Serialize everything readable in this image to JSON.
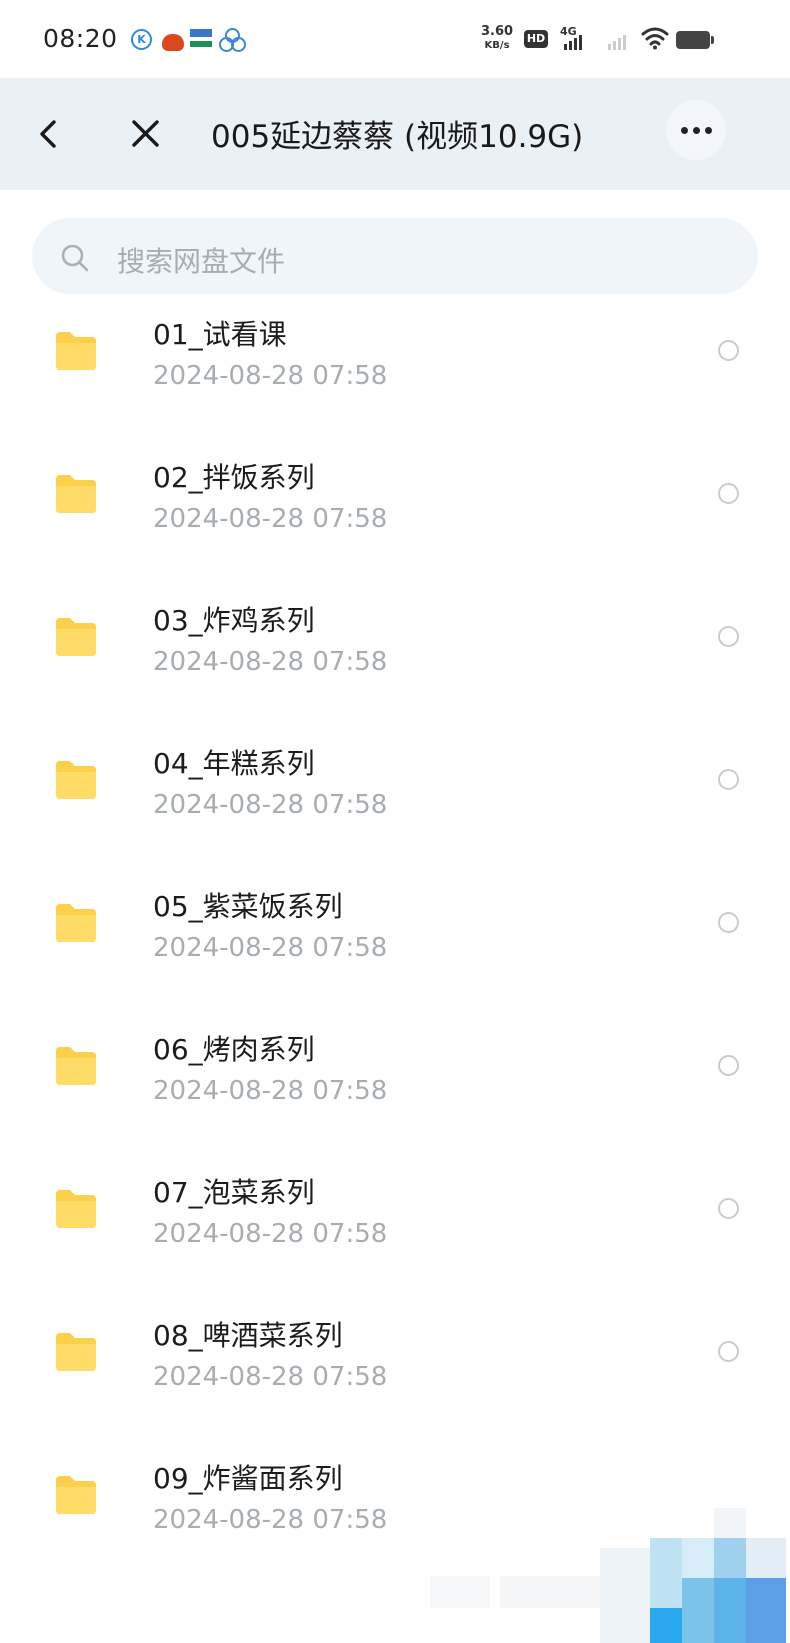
{
  "status_bar": {
    "time": "08:20",
    "net_speed_value": "3.60",
    "net_speed_unit": "KB/s",
    "hd_label": "HD",
    "network_label": "4G",
    "app_icons": [
      "k-app-icon",
      "cooking-pot-icon",
      "boat-app-icon",
      "rings-app-icon"
    ]
  },
  "title_bar": {
    "title": "005延边蔡蔡 (视频10.9G)",
    "back_icon": "chevron-left-icon",
    "close_icon": "close-icon",
    "more_icon": "more-horizontal-icon"
  },
  "search": {
    "placeholder": "搜索网盘文件",
    "icon": "search-icon"
  },
  "files": [
    {
      "name": "01_试看课",
      "date": "2024-08-28  07:58"
    },
    {
      "name": "02_拌饭系列",
      "date": "2024-08-28  07:58"
    },
    {
      "name": "03_炸鸡系列",
      "date": "2024-08-28  07:58"
    },
    {
      "name": "04_年糕系列",
      "date": "2024-08-28  07:58"
    },
    {
      "name": "05_紫菜饭系列",
      "date": "2024-08-28  07:58"
    },
    {
      "name": "06_烤肉系列",
      "date": "2024-08-28  07:58"
    },
    {
      "name": "07_泡菜系列",
      "date": "2024-08-28  07:58"
    },
    {
      "name": "08_啤酒菜系列",
      "date": "2024-08-28  07:58"
    },
    {
      "name": "09_炸酱面系列",
      "date": "2024-08-28  07:58"
    }
  ],
  "colors": {
    "folder": "#fcd04a",
    "title_bar_bg": "#e9f0f6",
    "search_bg": "#f0f5f9",
    "date_text": "#a8adb2"
  }
}
